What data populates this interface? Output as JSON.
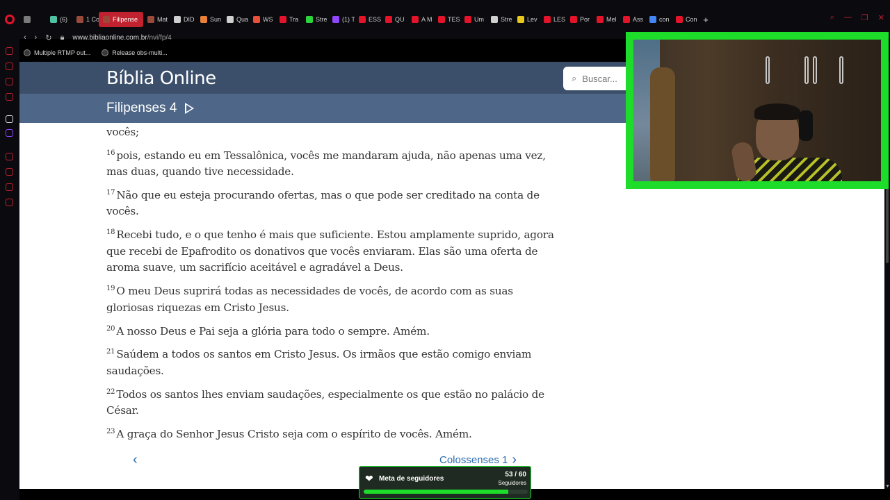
{
  "browser": {
    "tabs": [
      {
        "label": "",
        "color": "#7a7a7a"
      },
      {
        "label": "(6)",
        "color": "#4fc2a5"
      },
      {
        "label": "1 Co",
        "color": "#9a4a3a"
      },
      {
        "label": "Filipense",
        "color": "#9a4a3a",
        "active": true
      },
      {
        "label": "Mat",
        "color": "#9a4a3a"
      },
      {
        "label": "DID",
        "color": "#cfcfcf"
      },
      {
        "label": "Sun",
        "color": "#e8803a"
      },
      {
        "label": "Qua",
        "color": "#cfcfcf"
      },
      {
        "label": "WS",
        "color": "#e8503a"
      },
      {
        "label": "Tra",
        "color": "#e3132a"
      },
      {
        "label": "Stre",
        "color": "#2cd43c"
      },
      {
        "label": "(1) T",
        "color": "#9146ff"
      },
      {
        "label": "ESS",
        "color": "#e3132a"
      },
      {
        "label": "QU",
        "color": "#e3132a"
      },
      {
        "label": "A M",
        "color": "#e3132a"
      },
      {
        "label": "TES",
        "color": "#e3132a"
      },
      {
        "label": "Um",
        "color": "#e3132a"
      },
      {
        "label": "Stre",
        "color": "#cfcfcf"
      },
      {
        "label": "Lev",
        "color": "#e8c81a"
      },
      {
        "label": "LES",
        "color": "#e3132a"
      },
      {
        "label": "Por",
        "color": "#e3132a"
      },
      {
        "label": "Mel",
        "color": "#e3132a"
      },
      {
        "label": "Ass",
        "color": "#e3132a"
      },
      {
        "label": "con",
        "color": "#4285f4"
      },
      {
        "label": "Con",
        "color": "#e3132a"
      }
    ],
    "url_domain": "www.bibliaonline.com.br",
    "url_path": "/nvi/fp/4",
    "bookmarks": [
      "Multiple RTMP out...",
      "Release obs-multi..."
    ]
  },
  "site": {
    "title": "Bíblia Online",
    "search_placeholder": "Buscar...",
    "chapter": "Filipenses 4"
  },
  "content": {
    "partial_line": "vocês;",
    "verses": [
      {
        "num": "16",
        "text": "pois, estando eu em Tessalônica, vocês me mandaram ajuda, não apenas uma vez, mas duas, quando tive necessidade."
      },
      {
        "num": "17",
        "text": "Não que eu esteja procurando ofertas, mas o que pode ser creditado na conta de vocês."
      },
      {
        "num": "18",
        "text": "Recebi tudo, e o que tenho é mais que suficiente. Estou amplamente suprido, agora que recebi de Epafrodito os donativos que vocês enviaram. Elas são uma oferta de aroma suave, um sacrifício aceitável e agradável a Deus."
      },
      {
        "num": "19",
        "text": "O meu Deus suprirá todas as necessidades de vocês, de acordo com as suas gloriosas riquezas em Cristo Jesus."
      },
      {
        "num": "20",
        "text": "A nosso Deus e Pai seja a glória para todo o sempre. Amém."
      },
      {
        "num": "21",
        "text": "Saúdem a todos os santos em Cristo Jesus. Os irmãos que estão comigo enviam saudações."
      },
      {
        "num": "22",
        "text": "Todos os santos lhes enviam saudações, especialmente os que estão no palácio de César."
      },
      {
        "num": "23",
        "text": "A graça do Senhor Jesus Cristo seja com o espírito de vocês. Amém."
      }
    ],
    "next_chapter": "Colossenses 1"
  },
  "goal": {
    "label": "Meta de seguidores",
    "count": "53 / 60",
    "unit": "Seguidores",
    "progress": 0.883
  },
  "colors": {
    "header_top": "#3c4f6a",
    "header_sub": "#4e6789",
    "link": "#2b6cb0",
    "cam_border": "#1edc2a",
    "opera_red": "#e3132a"
  }
}
